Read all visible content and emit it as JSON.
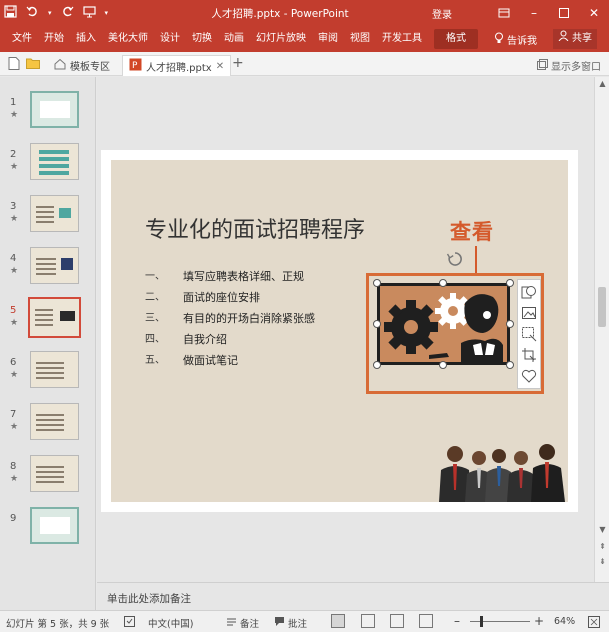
{
  "window": {
    "title": "人才招聘.pptx - PowerPoint",
    "login": "登录"
  },
  "ribbon": {
    "tabs": [
      "文件",
      "开始",
      "插入",
      "美化大师",
      "设计",
      "切换",
      "动画",
      "幻灯片放映",
      "审阅",
      "视图",
      "开发工具"
    ],
    "format_tab": "格式",
    "tell_me": "告诉我",
    "share": "共享"
  },
  "doc_tabs": {
    "template_tab": "模板专区",
    "active_tab": "人才招聘.pptx",
    "multi_window": "显示多窗口"
  },
  "thumbnails": {
    "numbers": [
      "1",
      "2",
      "3",
      "4",
      "5",
      "6",
      "7",
      "8",
      "9"
    ],
    "star": "★",
    "active_index": 5
  },
  "slide": {
    "title": "专业化的面试招聘程序",
    "bullets": [
      {
        "marker": "一、",
        "text": "填写应聘表格详细、正规"
      },
      {
        "marker": "二、",
        "text": "面试的座位安排"
      },
      {
        "marker": "三、",
        "text": "有目的的开场白消除紧张感"
      },
      {
        "marker": "四、",
        "text": "自我介绍"
      },
      {
        "marker": "五、",
        "text": "做面试笔记"
      }
    ],
    "callout": "查看"
  },
  "notes": {
    "placeholder": "单击此处添加备注"
  },
  "status": {
    "slide_info": "幻灯片 第 5 张，共 9 张",
    "language": "中文(中国)",
    "notes_btn": "备注",
    "comments_btn": "批注",
    "zoom": "64%"
  },
  "colors": {
    "accent": "#c23d2e",
    "callout": "#d45a2c",
    "slide_bg": "#e3dacb"
  }
}
